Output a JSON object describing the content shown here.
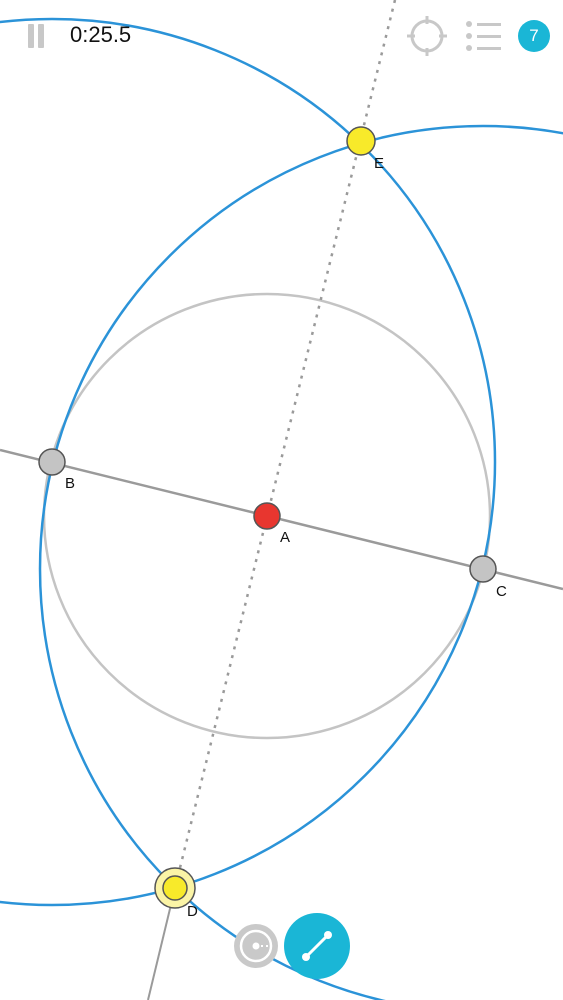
{
  "timer": "0:25.5",
  "level_badge": "7",
  "colors": {
    "blue_circle": "#2b93d8",
    "gray_circle": "#c4c4c4",
    "line": "#9a9a9a",
    "point_center": "#e8362f",
    "point_gray": "#c4c4c4",
    "point_yellow": "#f8ea2a",
    "accent": "#1ab6d6"
  },
  "icons": {
    "pause": "pause-icon",
    "target": "crosshair-icon",
    "list": "list-icon",
    "compass_tool": "circle-tool-icon",
    "line_tool": "line-tool-icon"
  },
  "points": {
    "A": {
      "label": "A"
    },
    "B": {
      "label": "B"
    },
    "C": {
      "label": "C"
    },
    "D": {
      "label": "D"
    },
    "E": {
      "label": "E"
    }
  }
}
